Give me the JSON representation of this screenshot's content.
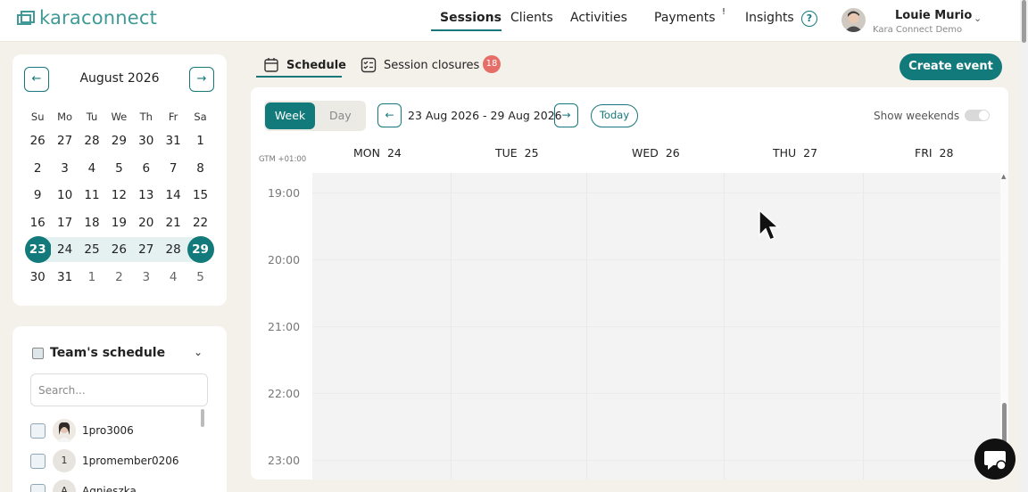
{
  "header": {
    "logo_text": "karaconnect",
    "nav": [
      {
        "label": "Sessions",
        "active": true
      },
      {
        "label": "Clients"
      },
      {
        "label": "Activities"
      },
      {
        "label": "Payments",
        "marker": "!"
      },
      {
        "label": "Insights"
      }
    ],
    "help_symbol": "?",
    "user_name": "Louie Murio",
    "user_org": "Kara Connect Demo",
    "colors": {
      "accent": "#137a7c",
      "badge": "#e66e69"
    }
  },
  "calendar": {
    "month_label": "August 2026",
    "prev_icon": "←",
    "next_icon": "→",
    "weekdays": [
      "Su",
      "Mo",
      "Tu",
      "We",
      "Th",
      "Fr",
      "Sa"
    ],
    "weeks": [
      [
        "26",
        "27",
        "28",
        "29",
        "30",
        "31",
        "1"
      ],
      [
        "2",
        "3",
        "4",
        "5",
        "6",
        "7",
        "8"
      ],
      [
        "9",
        "10",
        "11",
        "12",
        "13",
        "14",
        "15"
      ],
      [
        "16",
        "17",
        "18",
        "19",
        "20",
        "21",
        "22"
      ],
      [
        "23",
        "24",
        "25",
        "26",
        "27",
        "28",
        "29"
      ],
      [
        "30",
        "31",
        "1",
        "2",
        "3",
        "4",
        "5"
      ]
    ],
    "selected_range": [
      "23",
      "29"
    ]
  },
  "team": {
    "title": "Team's schedule",
    "search_placeholder": "Search...",
    "members": [
      {
        "name": "1pro3006",
        "avatar": "photo"
      },
      {
        "name": "1promember0206",
        "avatar": "1"
      },
      {
        "name": "Agnieszka",
        "avatar": "A"
      }
    ]
  },
  "tabs": [
    {
      "label": "Schedule",
      "icon": "calendar-icon",
      "active": true
    },
    {
      "label": "Session closures",
      "icon": "checklist-icon",
      "badge": "18"
    }
  ],
  "create_event_label": "Create event",
  "schedule": {
    "view_options": [
      "Week",
      "Day"
    ],
    "active_view": "Week",
    "date_range": "23 Aug 2026 - 29 Aug 2026",
    "today_label": "Today",
    "show_weekends_label": "Show weekends",
    "show_weekends": false,
    "timezone": "GTM +01:00",
    "days": [
      {
        "dow": "MON",
        "num": "24"
      },
      {
        "dow": "TUE",
        "num": "25"
      },
      {
        "dow": "WED",
        "num": "26"
      },
      {
        "dow": "THU",
        "num": "27"
      },
      {
        "dow": "FRI",
        "num": "28"
      }
    ],
    "hours": [
      "19:00",
      "20:00",
      "21:00",
      "22:00",
      "23:00"
    ]
  }
}
